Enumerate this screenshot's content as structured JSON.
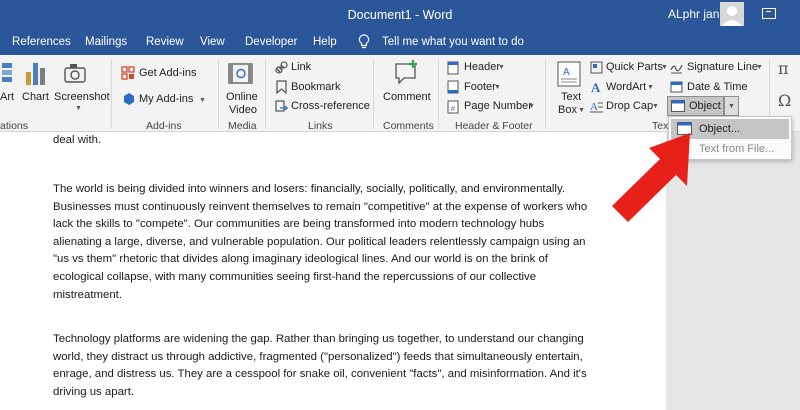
{
  "window": {
    "title": "Document1 - Word",
    "user": "ALphr jan"
  },
  "tabs": [
    {
      "label": "References"
    },
    {
      "label": "Mailings"
    },
    {
      "label": "Review"
    },
    {
      "label": "View"
    },
    {
      "label": "Developer"
    },
    {
      "label": "Help"
    }
  ],
  "tell_me": "Tell me what you want to do",
  "ribbon": {
    "illustrations": {
      "art": "Art",
      "chart": "Chart",
      "screenshot": "Screenshot",
      "group": "ations"
    },
    "addins": {
      "get": "Get Add-ins",
      "my": "My Add-ins",
      "group": "Add-ins"
    },
    "media": {
      "online": "Online",
      "video": "Video",
      "group": "Media"
    },
    "links": {
      "link": "Link",
      "bookmark": "Bookmark",
      "crossref": "Cross-reference",
      "group": "Links"
    },
    "comments": {
      "comment": "Comment",
      "group": "Comments"
    },
    "header_footer": {
      "header": "Header",
      "footer": "Footer",
      "page_number": "Page Number",
      "group": "Header & Footer"
    },
    "text": {
      "text_box_1": "Text",
      "text_box_2": "Box",
      "quick_parts": "Quick Parts",
      "wordart": "WordArt",
      "drop_cap": "Drop Cap",
      "signature": "Signature Line",
      "date_time": "Date & Time",
      "object": "Object",
      "group": "Text"
    },
    "symbols": {
      "pi": "π",
      "omega": "Ω"
    }
  },
  "menu": {
    "object": "Object...",
    "text_from_file": "Text from File..."
  },
  "document": {
    "paragraphs": [
      "deal with.",
      "The world is being divided into winners and losers: financially, socially, politically, and environmentally. Businesses must continuously reinvent themselves to remain \"competitive\" at the expense of workers who lack the skills to \"compete\". Our communities are being transformed into modern technology hubs alienating a large, diverse, and vulnerable population. Our political leaders relentlessly campaign using an \"us vs them\" rhetoric that divides along imaginary ideological lines. And our world is on the brink of ecological collapse, with many communities seeing first-hand the repercussions of our collective mistreatment.",
      "Technology platforms are widening the gap. Rather than bringing us together, to understand our changing world, they distract us through addictive, fragmented (\"personalized\") feeds that simultaneously entertain, enrage, and distress us. They are a cesspool for snake oil, convenient \"facts\", and misinformation. And it's driving us apart."
    ]
  },
  "colors": {
    "title_blue": "#2b579a",
    "ribbon_bg": "#f3f3f3",
    "annotation_red": "#e8201a"
  }
}
